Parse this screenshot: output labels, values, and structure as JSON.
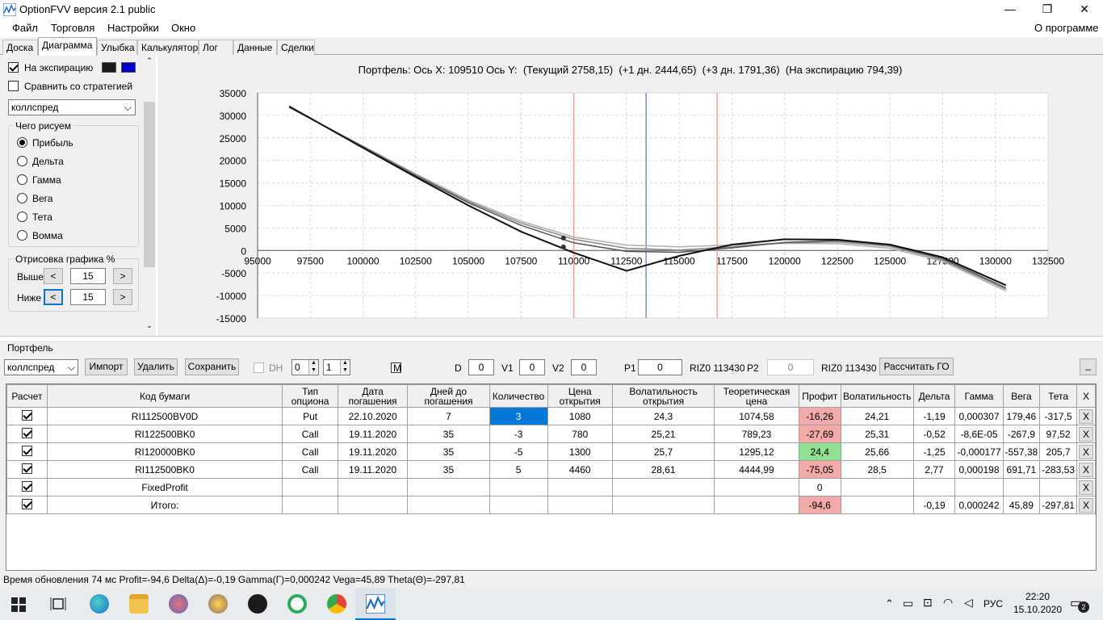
{
  "window": {
    "title": "OptionFVV версия 2.1 public",
    "minimize": "—",
    "maximize": "❐",
    "close": "✕"
  },
  "menu": {
    "items": [
      "Файл",
      "Торговля",
      "Настройки",
      "Окно"
    ],
    "about": "О программе"
  },
  "tabs": [
    "Доска",
    "Диаграмма",
    "Улыбка",
    "Калькулятор",
    "Лог",
    "Данные",
    "Сделки"
  ],
  "active_tab": "Диаграмма",
  "left": {
    "expiry_label": "На экспирацию",
    "expiry_checked": true,
    "color1": "#1a1a1a",
    "color2": "#0000cc",
    "compare_label": "Сравнить со стратегией",
    "compare_checked": false,
    "strategy": "коллспред",
    "draw_group": "Чего рисуем",
    "draw_options": [
      "Прибыль",
      "Дельта",
      "Гамма",
      "Вега",
      "Тета",
      "Вомма"
    ],
    "draw_selected": "Прибыль",
    "range_group": "Отрисовка графика %",
    "above_label": "Выше",
    "above_value": "15",
    "below_label": "Ниже",
    "below_value": "15",
    "arrow_left": "<",
    "arrow_right": ">"
  },
  "chart_header": "Портфель: Ось X: 109510 Ось Y:  (Текущий 2758,15)  (+1 дн. 2444,65)  (+3 дн. 1791,36)  (На экспирацию 794,39)",
  "chart_data": {
    "type": "line",
    "xlim": [
      95000,
      132500
    ],
    "ylim": [
      -15000,
      35000
    ],
    "x_ticks": [
      "95000",
      "97500",
      "100000",
      "102500",
      "105000",
      "107500",
      "110000",
      "112500",
      "115000",
      "117500",
      "120000",
      "122500",
      "125000",
      "127500",
      "130000",
      "132500"
    ],
    "y_ticks": [
      "35000",
      "30000",
      "25000",
      "20000",
      "15000",
      "10000",
      "5000",
      "0",
      "-5000",
      "-10000",
      "-15000"
    ],
    "grid": true,
    "vertical_lines": [
      {
        "x": 110000,
        "color": "#f0a0a0"
      },
      {
        "x": 113430,
        "color": "#8090b0"
      },
      {
        "x": 116800,
        "color": "#f0a0a0"
      }
    ],
    "series": [
      {
        "color": "#111111",
        "points": [
          [
            96500,
            32000
          ],
          [
            100000,
            22800
          ],
          [
            102500,
            16300
          ],
          [
            105000,
            10000
          ],
          [
            107500,
            4200
          ],
          [
            110000,
            -500
          ],
          [
            112500,
            -4500
          ],
          [
            115000,
            -1200
          ],
          [
            117500,
            1300
          ],
          [
            120000,
            2500
          ],
          [
            122500,
            2400
          ],
          [
            125000,
            1300
          ],
          [
            127500,
            -1500
          ],
          [
            130500,
            -7700
          ]
        ]
      },
      {
        "color": "#555555",
        "points": [
          [
            96500,
            31900
          ],
          [
            100000,
            23000
          ],
          [
            102500,
            16600
          ],
          [
            105000,
            10600
          ],
          [
            107500,
            5600
          ],
          [
            110000,
            1700
          ],
          [
            112500,
            -200
          ],
          [
            115000,
            -400
          ],
          [
            117500,
            600
          ],
          [
            120000,
            1800
          ],
          [
            122500,
            2200
          ],
          [
            125000,
            1200
          ],
          [
            127500,
            -1800
          ],
          [
            130500,
            -8300
          ]
        ]
      },
      {
        "color": "#888888",
        "points": [
          [
            96500,
            31800
          ],
          [
            100000,
            23100
          ],
          [
            102500,
            16800
          ],
          [
            105000,
            10900
          ],
          [
            107500,
            6100
          ],
          [
            110000,
            2500
          ],
          [
            112500,
            500
          ],
          [
            115000,
            100
          ],
          [
            117500,
            800
          ],
          [
            120000,
            1700
          ],
          [
            122500,
            1900
          ],
          [
            125000,
            900
          ],
          [
            127500,
            -2100
          ],
          [
            130500,
            -8600
          ]
        ]
      },
      {
        "color": "#b0b0b0",
        "points": [
          [
            96500,
            31700
          ],
          [
            100000,
            23200
          ],
          [
            102500,
            17000
          ],
          [
            105000,
            11200
          ],
          [
            107500,
            6500
          ],
          [
            110000,
            3000
          ],
          [
            112500,
            1200
          ],
          [
            115000,
            800
          ],
          [
            117500,
            1200
          ],
          [
            120000,
            1600
          ],
          [
            122500,
            1500
          ],
          [
            125000,
            500
          ],
          [
            127500,
            -2400
          ],
          [
            130500,
            -9000
          ]
        ]
      }
    ],
    "markers": [
      [
        109510,
        794.39
      ],
      [
        109510,
        2758.15
      ]
    ]
  },
  "portfolio": {
    "group_label": "Портфель",
    "strategy": "коллспред",
    "import": "Импорт",
    "delete": "Удалить",
    "save": "Сохранить",
    "dh_label": "DH",
    "spin1": "0",
    "spin2": "1",
    "m_label": "M",
    "d_label": "D",
    "d_value": "0",
    "v1_label": "V1",
    "v1_value": "0",
    "v2_label": "V2",
    "v2_value": "0",
    "p1_label": "P1",
    "p1_value": "0",
    "p1_sec": "RIZ0 113430",
    "p2_label": "P2",
    "p2_value": "0",
    "p2_sec": "RIZ0 113430",
    "calc_go": "Рассчитать ГО",
    "minimize": "_"
  },
  "table": {
    "headers": [
      "Расчет",
      "Код бумаги",
      "Тип опциона",
      "Дата погашения",
      "Дней до погашения",
      "Количество",
      "Цена открытия",
      "Волатильность открытия",
      "Теоретическая цена",
      "Профит",
      "Волатильность",
      "Дельта",
      "Гамма",
      "Вега",
      "Тета",
      "X"
    ],
    "rows": [
      {
        "cells": [
          "",
          "RI112500BV0D",
          "Put",
          "22.10.2020",
          "7",
          "3",
          "1080",
          "24,3",
          "1074,58",
          "-16,26",
          "24,21",
          "-1,19",
          "0,000307",
          "179,46",
          "-317,5",
          "X"
        ],
        "profit": "neg",
        "sel": 5
      },
      {
        "cells": [
          "",
          "RI122500BK0",
          "Call",
          "19.11.2020",
          "35",
          "-3",
          "780",
          "25,21",
          "789,23",
          "-27,69",
          "25,31",
          "-0,52",
          "-8,6E-05",
          "-267,9",
          "97,52",
          "X"
        ],
        "profit": "neg"
      },
      {
        "cells": [
          "",
          "RI120000BK0",
          "Call",
          "19.11.2020",
          "35",
          "-5",
          "1300",
          "25,7",
          "1295,12",
          "24,4",
          "25,66",
          "-1,25",
          "-0,000177",
          "-557,38",
          "205,7",
          "X"
        ],
        "profit": "pos"
      },
      {
        "cells": [
          "",
          "RI112500BK0",
          "Call",
          "19.11.2020",
          "35",
          "5",
          "4460",
          "28,61",
          "4444,99",
          "-75,05",
          "28,5",
          "2,77",
          "0,000198",
          "691,71",
          "-283,53",
          "X"
        ],
        "profit": "neg"
      },
      {
        "cells": [
          "",
          "FixedProfit",
          "",
          "",
          "",
          "",
          "",
          "",
          "",
          "0",
          "",
          "",
          "",
          "",
          "",
          "X"
        ],
        "profit": ""
      },
      {
        "cells": [
          "",
          "Итого:",
          "",
          "",
          "",
          "",
          "",
          "",
          "",
          "-94,6",
          "",
          "-0,19",
          "0,000242",
          "45,89",
          "-297,81",
          "X"
        ],
        "profit": "neg"
      }
    ]
  },
  "status": "Время обновления 74 мс  Profit=-94,6 Delta(Δ)=-0,19 Gamma(Γ)=0,000242 Vega=45,89 Theta(Θ)=-297,81",
  "taskbar": {
    "lang": "РУС",
    "time": "22:20",
    "date": "15.10.2020",
    "notif": "2"
  }
}
